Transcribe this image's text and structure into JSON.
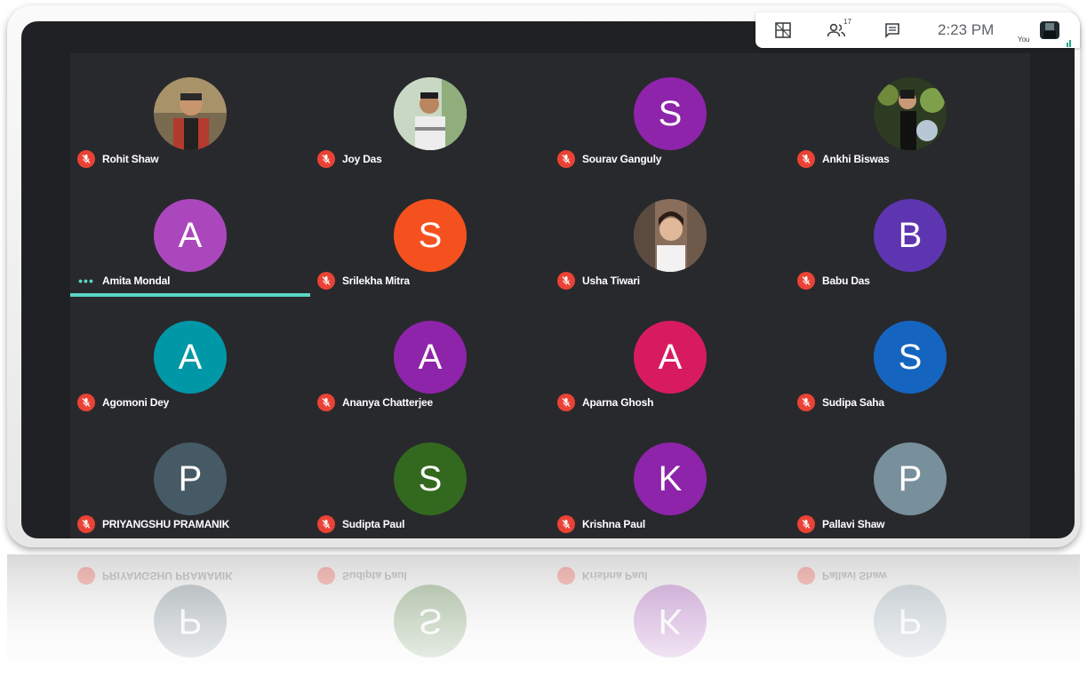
{
  "topbar": {
    "layout_icon": "tile-grid-icon",
    "participants_icon": "people-icon",
    "participants_count": "17",
    "chat_icon": "chat-icon",
    "time": "2:23 PM",
    "self_label": "You"
  },
  "participants": [
    {
      "name": "Rohit Shaw",
      "type": "photo",
      "muted": true
    },
    {
      "name": "Joy Das",
      "type": "photo",
      "muted": true
    },
    {
      "name": "Sourav Ganguly",
      "type": "letter",
      "letter": "S",
      "color": "#8e24aa",
      "muted": true
    },
    {
      "name": "Ankhi Biswas",
      "type": "photo",
      "muted": true
    },
    {
      "name": "Amita Mondal",
      "type": "letter",
      "letter": "A",
      "color": "#ab47bc",
      "muted": false,
      "speaking": true
    },
    {
      "name": "Srilekha Mitra",
      "type": "letter",
      "letter": "S",
      "color": "#f4511e",
      "muted": true
    },
    {
      "name": "Usha Tiwari",
      "type": "photo",
      "muted": true
    },
    {
      "name": "Babu Das",
      "type": "letter",
      "letter": "B",
      "color": "#5e35b1",
      "muted": true
    },
    {
      "name": "Agomoni Dey",
      "type": "letter",
      "letter": "A",
      "color": "#0097a7",
      "muted": true
    },
    {
      "name": "Ananya Chatterjee",
      "type": "letter",
      "letter": "A",
      "color": "#8e24aa",
      "muted": true
    },
    {
      "name": "Aparna Ghosh",
      "type": "letter",
      "letter": "A",
      "color": "#d81b60",
      "muted": true
    },
    {
      "name": "Sudipa Saha",
      "type": "letter",
      "letter": "S",
      "color": "#1565c0",
      "muted": true
    },
    {
      "name": "PRIYANGSHU PRAMANIK",
      "type": "letter",
      "letter": "P",
      "color": "#455a64",
      "muted": true
    },
    {
      "name": "Sudipta Paul",
      "type": "letter",
      "letter": "S",
      "color": "#33691e",
      "muted": true
    },
    {
      "name": "Krishna Paul",
      "type": "letter",
      "letter": "K",
      "color": "#8e24aa",
      "muted": true
    },
    {
      "name": "Pallavi Shaw",
      "type": "letter",
      "letter": "P",
      "color": "#78909c",
      "muted": true
    }
  ]
}
